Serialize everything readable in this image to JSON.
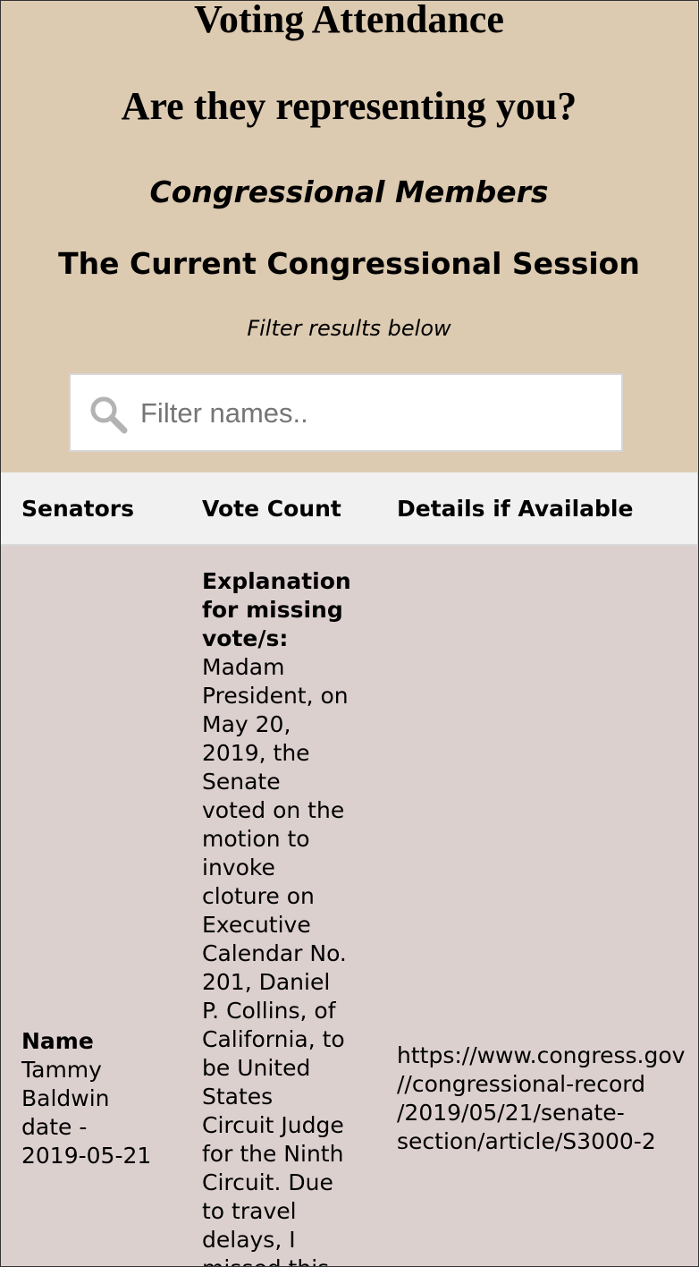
{
  "header": {
    "title": "Voting Attendance",
    "subtitle": "Are they representing you?",
    "members_heading": "Congressional Members",
    "session_heading": "The Current Congressional Session",
    "filter_note": "Filter results below"
  },
  "search": {
    "placeholder": "Filter names..",
    "value": "",
    "icon": "search-icon"
  },
  "table": {
    "columns": [
      "Senators",
      "Vote Count",
      "Details if Available"
    ],
    "rows": [
      {
        "name_label": "Name",
        "name_lines": [
          "Tammy",
          "Baldwin",
          "date -",
          "2019-05-21"
        ],
        "explanation_label_lines": [
          "Explanation",
          "for missing",
          "vote/s:"
        ],
        "explanation_lines": [
          "Madam",
          "President, on",
          "May 20,",
          "2019, the",
          "Senate",
          "voted on the",
          "motion to",
          "invoke",
          "cloture on",
          "Executive",
          "Calendar No.",
          "201, Daniel",
          "P. Collins, of",
          "California, to",
          "be United",
          "States",
          "Circuit Judge",
          "for the Ninth",
          "Circuit. Due",
          "to travel",
          "delays, I",
          "missed this"
        ],
        "details_lines": [
          "https://www.congress.gov",
          "//congressional-record",
          "/2019/05/21/senate-",
          "section/article/S3000-2"
        ]
      }
    ]
  }
}
